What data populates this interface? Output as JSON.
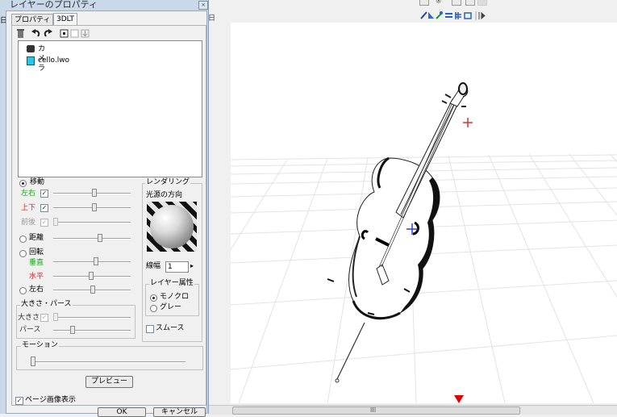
{
  "panel": {
    "title": "レイヤーのプロパティ",
    "close_glyph": "×",
    "tabs": [
      {
        "label": "プロパティ"
      },
      {
        "label": "3DLT"
      }
    ],
    "toolbar": {
      "delete": "trash-icon",
      "undo": "undo-icon",
      "redo": "redo-icon"
    },
    "layers": [
      {
        "name": "カメラ",
        "icon": "camera-icon"
      },
      {
        "name": "cello.lwo",
        "icon": "object-cube-icon"
      }
    ],
    "move": {
      "label": "移動",
      "lr": "左右",
      "ud": "上下",
      "fb": "前後",
      "distance": "距離",
      "rotate": "回転",
      "vertical": "垂直",
      "horizontal": "水平",
      "lr2": "左右"
    },
    "size_perspective": {
      "legend": "大きさ・パース",
      "size": "大きさ",
      "perspective": "パース"
    },
    "motion": {
      "legend": "モーション"
    },
    "rendering": {
      "legend": "レンダリング",
      "light_dir": "光源の方向",
      "line_width_label": "線幅",
      "line_width_value": "1",
      "layer_attr_legend": "レイヤー属性",
      "mono": "モノクロ",
      "gray": "グレー",
      "smooth": "スムース"
    },
    "preview_button": "プレビュー",
    "page_image_display": "ページ画像表示",
    "ok_button": "OK",
    "cancel_button": "キャンセル"
  },
  "scrollbar": {
    "grip": "III"
  },
  "colors": {
    "panel_bg": "#c9d9ea",
    "green_label": "#1aa51a",
    "red_label": "#e02020",
    "red_cross": "#e03030",
    "blue_cross": "#2a3ee0",
    "marker": "#e00000"
  }
}
